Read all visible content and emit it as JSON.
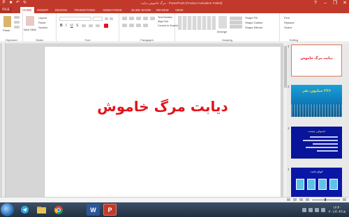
{
  "titlebar": {
    "title": "مرگ خاموش دیابت - PowerPoint (Product Activation Failed)"
  },
  "tabs": {
    "file": "FILE",
    "items": [
      "HOME",
      "INSERT",
      "DESIGN",
      "TRANSITIONS",
      "ANIMATIONS",
      "SLIDE SHOW",
      "REVIEW",
      "VIEW"
    ],
    "active": "HOME"
  },
  "ribbon": {
    "groups": [
      "Clipboard",
      "Slides",
      "Font",
      "Paragraph",
      "Drawing",
      "Editing"
    ],
    "paste_label": "Paste",
    "new_slide_label": "New Slide",
    "layout_label": "Layout",
    "reset_label": "Reset",
    "section_label": "Section",
    "arrange_label": "Arrange",
    "find_label": "Find",
    "replace_label": "Replace",
    "select_label": "Select",
    "shape_fill_label": "Shape Fill",
    "shape_outline_label": "Shape Outline",
    "shape_effects_label": "Shape Effects",
    "text_direction_label": "Text Direction",
    "align_text_label": "Align Text",
    "convert_smartart_label": "Convert to SmartArt"
  },
  "slide": {
    "title": "دیابت مرگ خاموش",
    "title_color": "#e3131b"
  },
  "thumbnails": [
    {
      "num": "1",
      "text": "دیابت مرگ خاموش"
    },
    {
      "num": "2",
      "text": "۳۴۶ میلیون نفر"
    },
    {
      "num": "3",
      "text": "انسولین چیست"
    },
    {
      "num": "4",
      "text": "انواع دیابت"
    }
  ],
  "taskbar": {
    "apps": [
      "telegram-icon",
      "explorer-icon",
      "chrome-icon",
      "word-icon",
      "powerpoint-icon"
    ],
    "word_label": "W",
    "ppt_label": "P",
    "clock_time": "۱۶:۲۰",
    "clock_date": "۲۰۱۶/۰۴/۱۸"
  },
  "colors": {
    "accent": "#c0392b",
    "slide_title": "#e3131b"
  }
}
